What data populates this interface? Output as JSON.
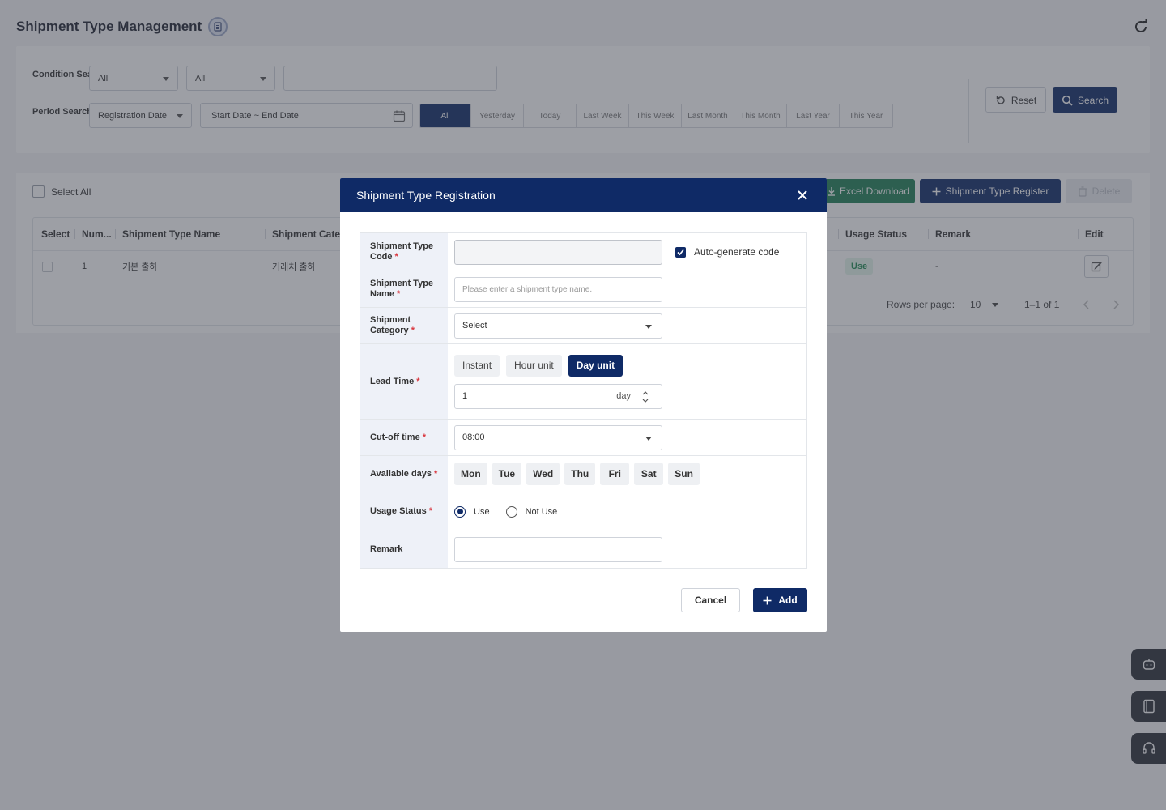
{
  "page": {
    "title": "Shipment Type Management"
  },
  "filters": {
    "condition_label": "Condition Search",
    "condition_select_1": "All",
    "condition_select_2": "All",
    "condition_input": "",
    "period_label": "Period Search",
    "period_type": "Registration Date",
    "date_range_placeholder": "Start Date ~ End Date",
    "period_options": [
      "All",
      "Yesterday",
      "Today",
      "Last Week",
      "This Week",
      "Last Month",
      "This Month",
      "Last Year",
      "This Year"
    ],
    "period_selected": "All",
    "reset_label": "Reset",
    "search_label": "Search"
  },
  "list": {
    "select_all_label": "Select All",
    "excel_label": "Excel Download",
    "register_label": "Shipment Type Register",
    "delete_label": "Delete",
    "columns": [
      "Select",
      "Num...",
      "Shipment Type Name",
      "Shipment Categ",
      "Usage Status",
      "Remark",
      "Edit"
    ],
    "rows": [
      {
        "num": "1",
        "name": "기본 출하",
        "category": "거래처 출하",
        "status": "Use",
        "remark": "-"
      }
    ],
    "rows_per_page_label": "Rows per page:",
    "rows_per_page": "10",
    "range": "1–1 of 1"
  },
  "modal": {
    "title": "Shipment Type Registration",
    "fields": {
      "code_label": "Shipment Type Code",
      "code_value": "",
      "autogen_label": "Auto-generate code",
      "autogen_checked": true,
      "name_label": "Shipment Type Name",
      "name_placeholder": "Please enter a shipment type name.",
      "category_label": "Shipment Category",
      "category_value": "Select",
      "lead_label": "Lead Time",
      "lead_options": [
        "Instant",
        "Hour unit",
        "Day unit"
      ],
      "lead_selected": "Day unit",
      "lead_value": "1",
      "lead_unit": "day",
      "cutoff_label": "Cut-off time",
      "cutoff_value": "08:00",
      "days_label": "Available days",
      "days": [
        "Mon",
        "Tue",
        "Wed",
        "Thu",
        "Fri",
        "Sat",
        "Sun"
      ],
      "usage_label": "Usage Status",
      "usage_options": [
        "Use",
        "Not Use"
      ],
      "usage_selected": "Use",
      "remark_label": "Remark",
      "remark_value": ""
    },
    "cancel_label": "Cancel",
    "add_label": "Add"
  },
  "colors": {
    "primary": "#0f2a66",
    "excel": "#1e7e55",
    "required": "#d9373f",
    "overlay": "rgba(60,64,76,0.5)"
  }
}
